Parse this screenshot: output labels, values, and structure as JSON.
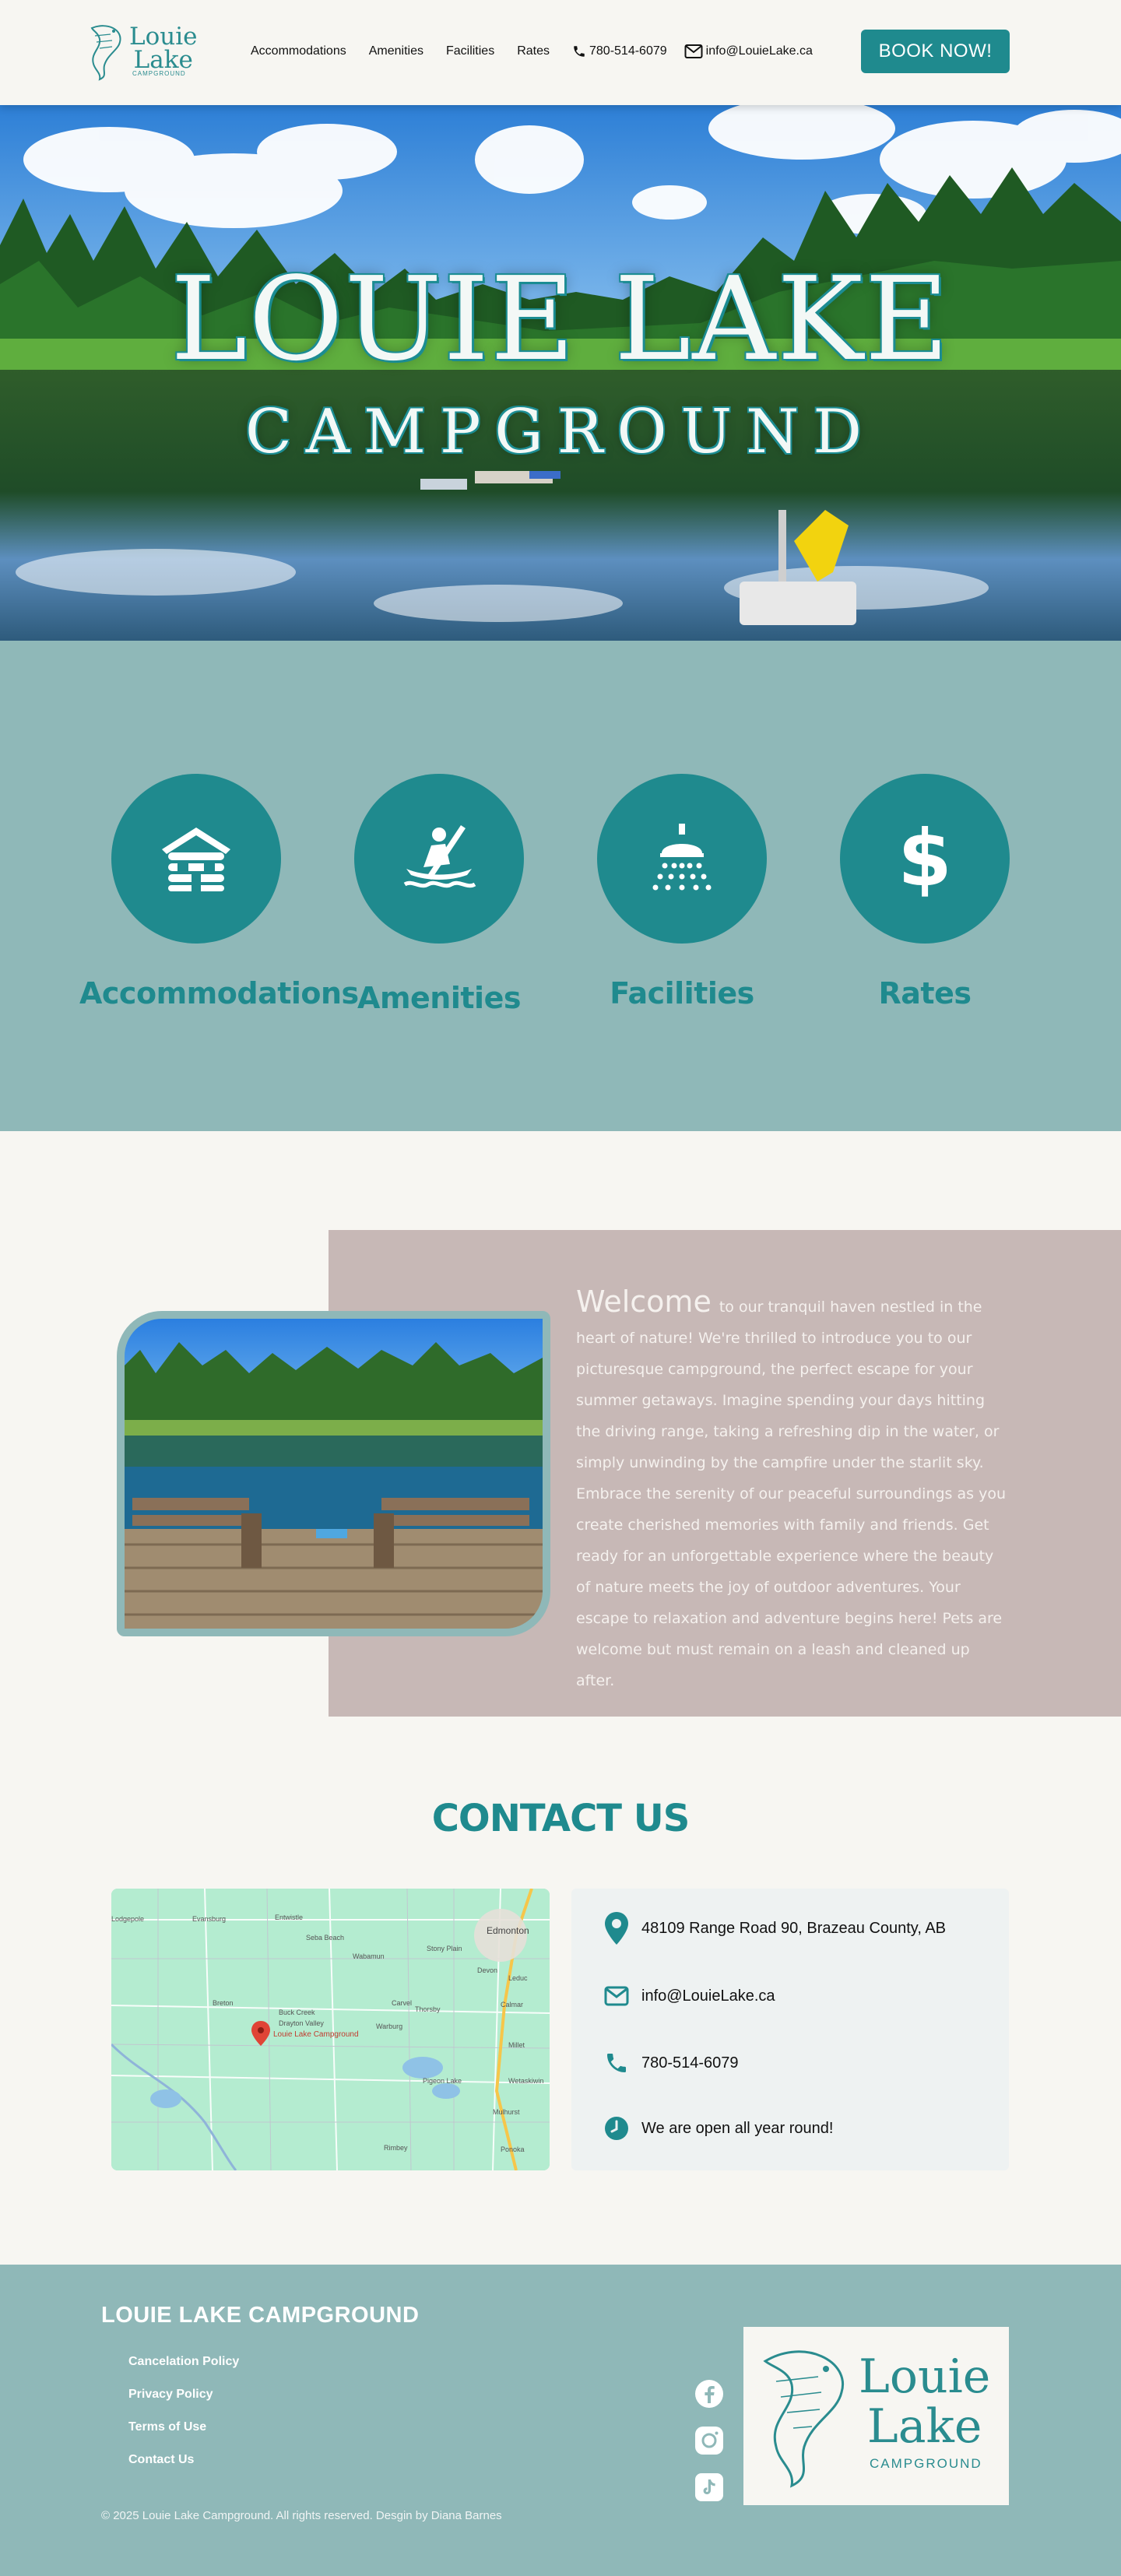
{
  "header": {
    "logo_line1": "Louie",
    "logo_line2": "Lake",
    "logo_sub": "CAMPGROUND",
    "nav": [
      "Accommodations",
      "Amenities",
      "Facilities",
      "Rates"
    ],
    "phone": "780-514-6079",
    "email": "info@LouieLake.ca",
    "book_label": "BOOK NOW!"
  },
  "hero": {
    "title": "LOUIE LAKE",
    "subtitle": "CAMPGROUND"
  },
  "features": [
    {
      "label": "Accommodations",
      "icon": "cabin-icon"
    },
    {
      "label": "Amenities",
      "icon": "kayak-icon"
    },
    {
      "label": "Facilities",
      "icon": "shower-icon"
    },
    {
      "label": "Rates",
      "icon": "dollar-icon"
    }
  ],
  "welcome": {
    "heading": "Welcome",
    "body": "to our tranquil haven nestled in the heart of nature! We're thrilled to introduce you to our picturesque campground, the perfect escape for your summer getaways. Imagine spending your days hitting the driving range, taking a refreshing dip in the water, or simply unwinding by the campfire under the starlit sky. Embrace the serenity of our peaceful surroundings as you create cherished memories with family and friends. Get ready for an unforgettable experience where the beauty of nature meets the joy of outdoor adventures. Your escape to relaxation and adventure begins here! Pets are welcome but must remain on a leash and cleaned up after."
  },
  "contact": {
    "title": "CONTACT US",
    "address": "48109 Range Road 90, Brazeau County, AB",
    "email": "info@LouieLake.ca",
    "phone": "780-514-6079",
    "hours": "We are open all year round!",
    "map_pin_label": "Louie Lake Campground",
    "map_places": [
      "Edmonton",
      "Entwistle",
      "Stony Plain",
      "Carvel",
      "Warburg",
      "Thorsby",
      "Calmar",
      "Breton",
      "Buck Creek",
      "Drayton Valley",
      "Millet",
      "Wetaskiwin",
      "Pigeon Lake",
      "Mulhurst",
      "Ponoka",
      "Rimbey",
      "Evansburg",
      "Wabamun",
      "Seba Beach",
      "Leduc",
      "Devon",
      "Lodgepole"
    ]
  },
  "footer": {
    "title": "LOUIE LAKE CAMPGROUND",
    "links": [
      "Cancelation Policy",
      "Privacy Policy",
      "Terms of Use",
      "Contact Us"
    ],
    "copyright": "© 2025 Louie Lake Campground. All rights reserved. Desgin by Diana Barnes",
    "logo_line1": "Louie",
    "logo_line2": "Lake",
    "logo_sub": "CAMPGROUND"
  },
  "colors": {
    "teal": "#1f8a8e",
    "sage": "#8fb8b8",
    "mauve": "#c7b8b6",
    "cream": "#f7f6f2"
  }
}
